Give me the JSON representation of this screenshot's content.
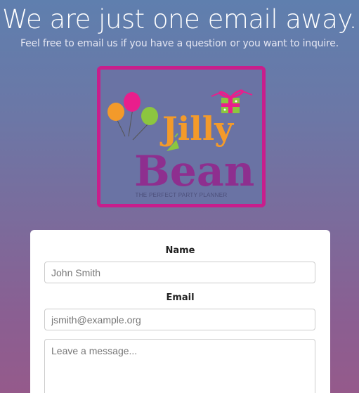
{
  "header": {
    "title": "We are just one email away.",
    "subtitle": "Feel free to email us if you have a question or you want to inquire."
  },
  "logo": {
    "word1": "Jilly",
    "word2": "Bean",
    "tagline": "THE PERFECT PARTY PLANNER",
    "frame_color": "#c81e8c",
    "orange": "#f39a2a",
    "purple": "#8e2f8f",
    "pink": "#e91e8c",
    "green": "#8cc63f"
  },
  "form": {
    "name_label": "Name",
    "name_placeholder": "John Smith",
    "email_label": "Email",
    "email_placeholder": "jsmith@example.org",
    "message_placeholder": "Leave a message..."
  }
}
